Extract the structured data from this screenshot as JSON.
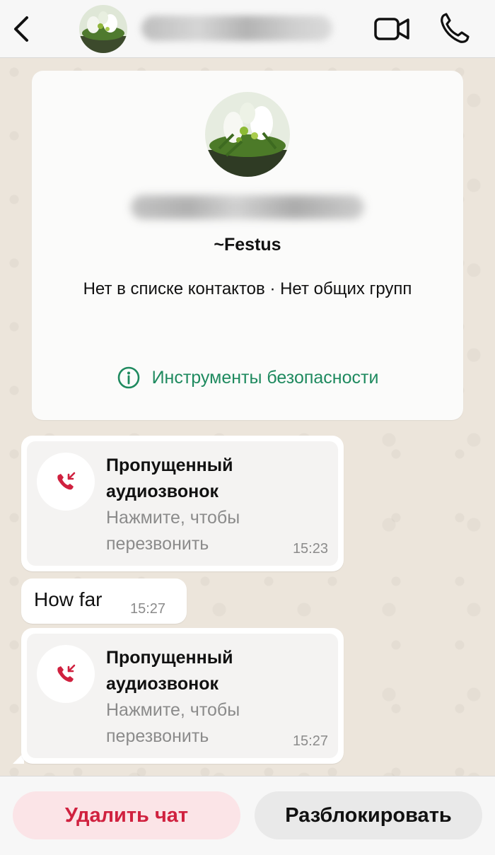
{
  "header": {
    "back_icon": "chevron-left-icon",
    "video_icon": "video-camera-icon",
    "call_icon": "phone-icon"
  },
  "contact": {
    "push_name": "~Festus",
    "info": "Нет в списке контактов · Нет общих групп",
    "safety_tools_label": "Инструменты безопасности",
    "safety_icon": "info-circle-icon"
  },
  "messages": [
    {
      "type": "missed_call",
      "title": "Пропущенный аудиозвонок",
      "subtitle": "Нажмите, чтобы перезвонить",
      "time": "15:23"
    },
    {
      "type": "text",
      "text": "How far",
      "time": "15:27"
    },
    {
      "type": "missed_call",
      "title": "Пропущенный аудиозвонок",
      "subtitle": "Нажмите, чтобы перезвонить",
      "time": "15:27"
    }
  ],
  "actions": {
    "delete_label": "Удалить чат",
    "unblock_label": "Разблокировать"
  },
  "colors": {
    "accent_green": "#1f8a5f",
    "missed_call_red": "#d0213f",
    "delete_bg": "#fbe4e7"
  }
}
